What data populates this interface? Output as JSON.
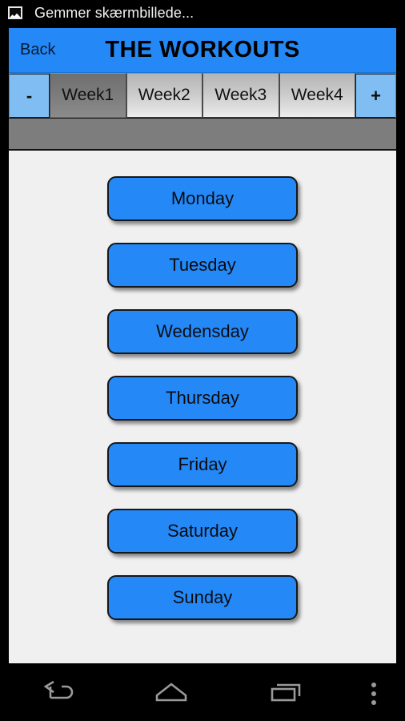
{
  "status_bar": {
    "icon": "image-screenshot-icon",
    "text": "Gemmer skærmbillede..."
  },
  "header": {
    "back_label": "Back",
    "title": "THE WORKOUTS",
    "background_color": "#2489F7"
  },
  "tabs": {
    "decrement_label": "-",
    "increment_label": "+",
    "selected_index": 0,
    "items": [
      {
        "label": "Week1",
        "selected": true
      },
      {
        "label": "Week2",
        "selected": false
      },
      {
        "label": "Week3",
        "selected": false
      },
      {
        "label": "Week4",
        "selected": false
      }
    ]
  },
  "days": [
    {
      "label": "Monday"
    },
    {
      "label": "Tuesday"
    },
    {
      "label": "Wedensday"
    },
    {
      "label": "Thursday"
    },
    {
      "label": "Friday"
    },
    {
      "label": "Saturday"
    },
    {
      "label": "Sunday"
    }
  ],
  "colors": {
    "accent_blue": "#2489F7",
    "tab_step_blue": "#7FBDF2",
    "grey_strip": "#7D7D7D",
    "content_background": "#F0F0F0"
  },
  "nav_bar": {
    "back": "back-icon",
    "home": "home-icon",
    "recents": "recent-apps-icon",
    "overflow": "overflow-menu-icon"
  }
}
